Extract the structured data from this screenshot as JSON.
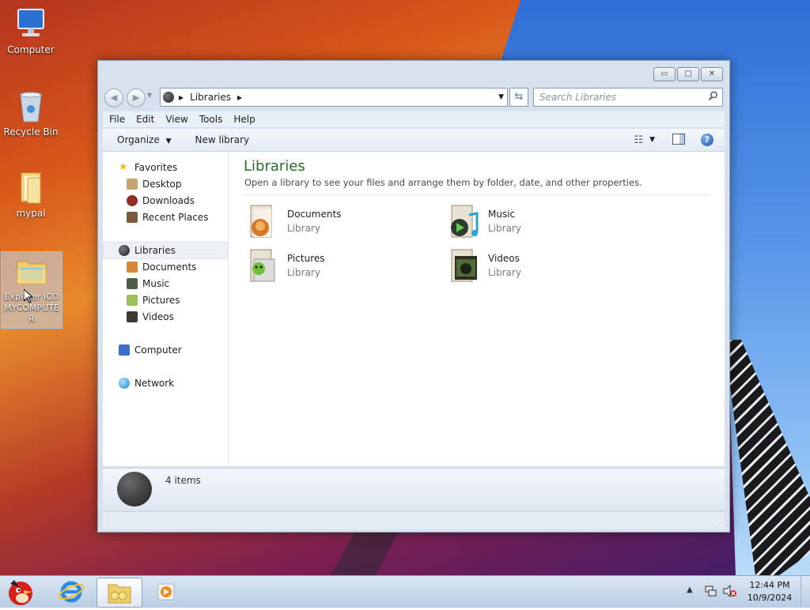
{
  "desktop": {
    "icons": [
      {
        "label": "Computer",
        "icon": "computer-icon"
      },
      {
        "label": "Recycle Bin",
        "icon": "recycle-bin-icon"
      },
      {
        "label": "mypal",
        "icon": "folder-icon"
      },
      {
        "label": "Explorer ICO MYCOMPUTER",
        "icon": "explorer-folder-icon"
      }
    ]
  },
  "window": {
    "controls": {
      "minimize": "▭",
      "maximize": "▢",
      "close": "✕"
    },
    "address": {
      "root": "Libraries"
    },
    "search": {
      "placeholder": "Search Libraries"
    },
    "menu": [
      "File",
      "Edit",
      "View",
      "Tools",
      "Help"
    ],
    "toolbar": {
      "organize": "Organize",
      "new_library": "New library"
    },
    "nav": {
      "favorites": {
        "label": "Favorites",
        "items": [
          "Desktop",
          "Downloads",
          "Recent Places"
        ]
      },
      "libraries": {
        "label": "Libraries",
        "items": [
          "Documents",
          "Music",
          "Pictures",
          "Videos"
        ]
      },
      "computer": "Computer",
      "network": "Network"
    },
    "main": {
      "title": "Libraries",
      "subtitle": "Open a library to see your files and arrange them by folder, date, and other properties.",
      "libraries": [
        {
          "name": "Documents",
          "type": "Library",
          "icon": "documents-library-icon"
        },
        {
          "name": "Music",
          "type": "Library",
          "icon": "music-library-icon"
        },
        {
          "name": "Pictures",
          "type": "Library",
          "icon": "pictures-library-icon"
        },
        {
          "name": "Videos",
          "type": "Library",
          "icon": "videos-library-icon"
        }
      ]
    },
    "details": {
      "count": "4 items"
    }
  },
  "taskbar": {
    "clock": {
      "time": "12:44 PM",
      "date": "10/9/2024"
    },
    "apps": [
      "angry-birds-start-icon",
      "internet-explorer-icon",
      "explorer-icon",
      "media-player-icon"
    ]
  },
  "colors": {
    "accent_title": "#1e5d8a",
    "library_title": "#2a6b2a"
  }
}
